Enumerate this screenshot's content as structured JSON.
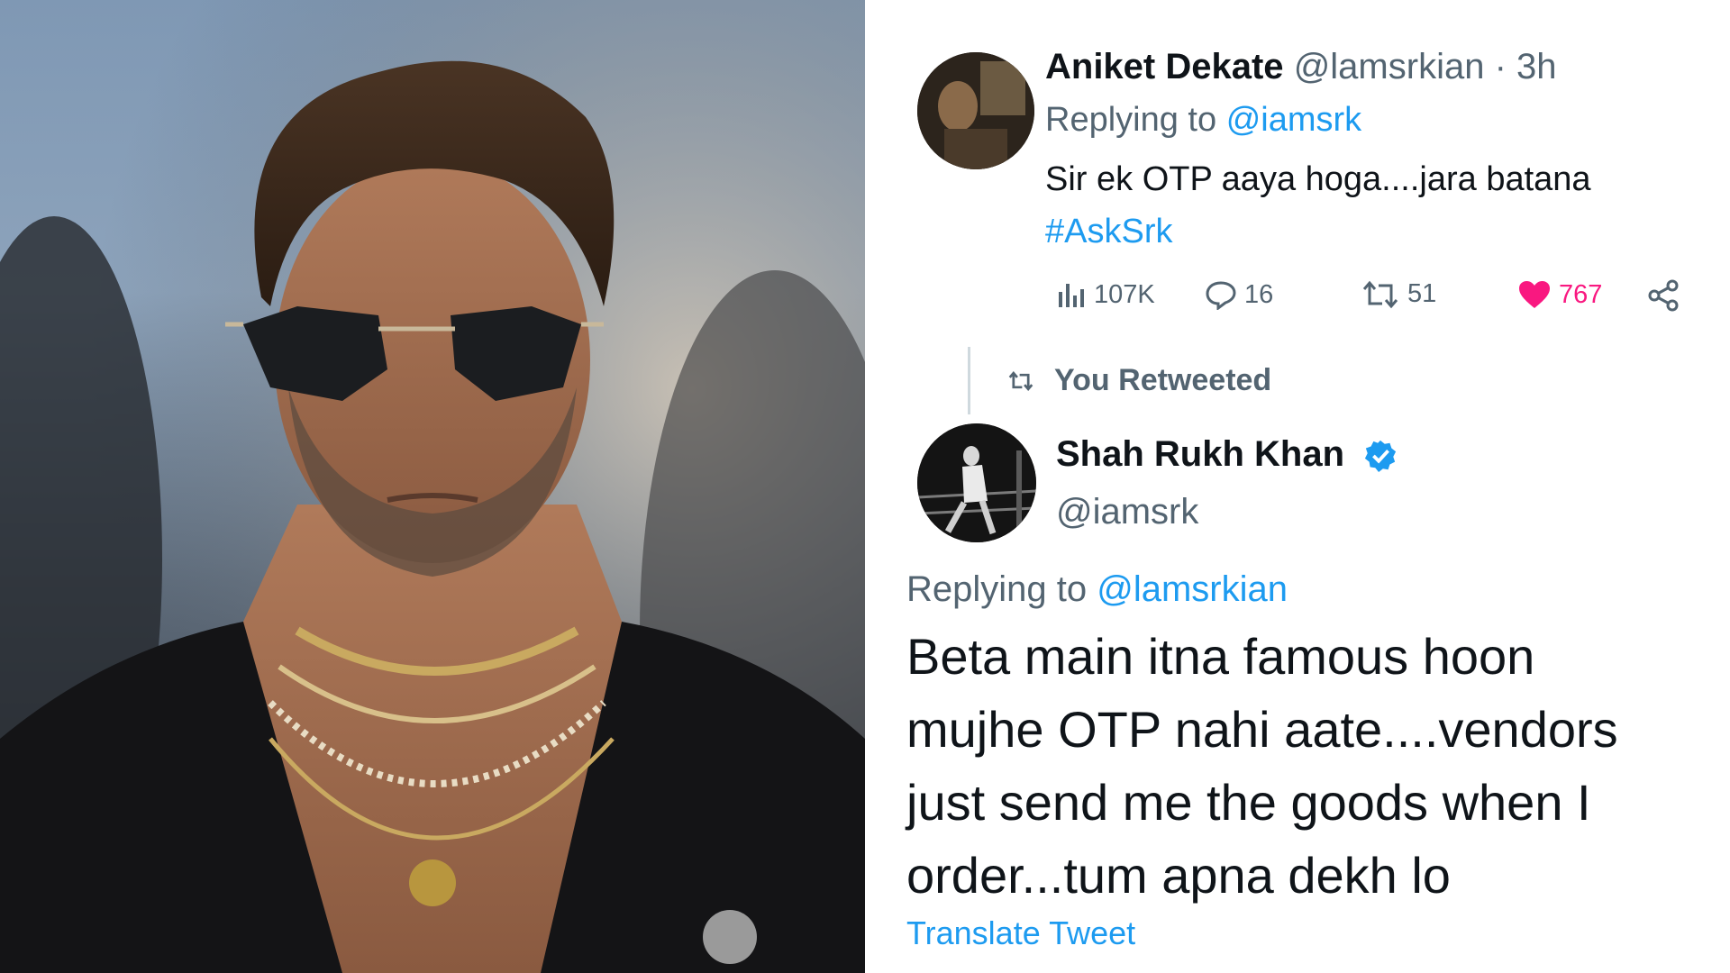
{
  "tweet1": {
    "author_name": "Aniket Dekate",
    "author_handle": "@lamsrkian",
    "separator": "·",
    "time": "3h",
    "replying_prefix": "Replying to",
    "replying_handle": "@iamsrk",
    "text": "Sir ek OTP aaya hoga....jara batana",
    "hashtag": "#AskSrk",
    "stats": {
      "views": "107K",
      "replies": "16",
      "retweets": "51",
      "likes": "767"
    }
  },
  "retweet_label": "You Retweeted",
  "tweet2": {
    "author_name": "Shah Rukh Khan",
    "author_handle": "@iamsrk",
    "replying_prefix": "Replying to",
    "replying_handle": "@lamsrkian",
    "text_line1": "Beta main itna famous hoon",
    "text_line2": "mujhe OTP nahi aate....vendors",
    "text_line3": "just send me the goods when I",
    "text_line4": "order...tum apna dekh lo",
    "translate": "Translate Tweet"
  },
  "colors": {
    "link": "#1d9bf0",
    "like": "#f91880",
    "muted": "#536471",
    "text": "#0f1419"
  },
  "icons": [
    "views-icon",
    "reply-icon",
    "retweet-icon",
    "heart-icon",
    "share-icon",
    "verified-badge-icon"
  ]
}
